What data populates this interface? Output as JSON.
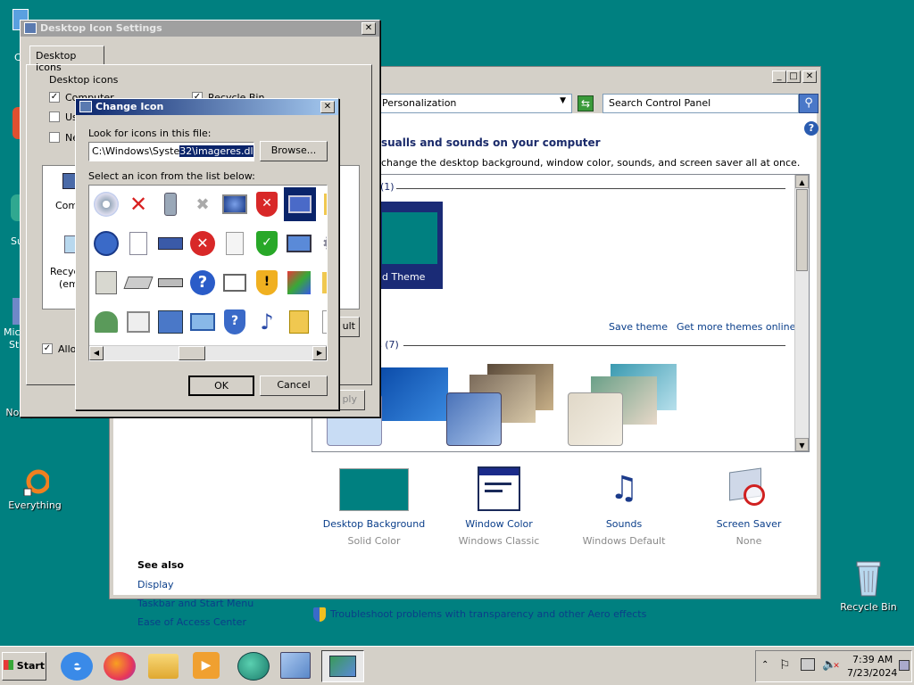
{
  "desktop": {
    "icons": [
      {
        "label": "Notepad++",
        "icon": "notepad-icon"
      },
      {
        "label": "Everything",
        "icon": "everything-icon"
      },
      {
        "label": "Recycle Bin",
        "icon": "recycle-bin-icon"
      }
    ],
    "partial_labels": [
      "C",
      "Su",
      "Micr",
      "Stu"
    ]
  },
  "control_panel": {
    "address": "Personalization",
    "search_placeholder": "Search Control Panel",
    "heading": "sualls and sounds on your computer",
    "subheading": "change the desktop background, window color, sounds, and screen saver all at once.",
    "my_themes_label": "(1)",
    "unsaved_theme_label": "d Theme",
    "save_theme": "Save theme",
    "get_more_themes": "Get more themes online",
    "basic_themes_label": "s (7)",
    "bottom_items": [
      {
        "title": "Desktop Background",
        "sub": "Solid Color",
        "icon": "desktop-background-icon"
      },
      {
        "title": "Window Color",
        "sub": "Windows Classic",
        "icon": "window-color-icon"
      },
      {
        "title": "Sounds",
        "sub": "Windows Default",
        "icon": "sounds-icon"
      },
      {
        "title": "Screen Saver",
        "sub": "None",
        "icon": "screen-saver-icon"
      }
    ],
    "see_also": "See also",
    "see_also_links": [
      "Display",
      "Taskbar and Start Menu",
      "Ease of Access Center"
    ],
    "troubleshoot": "Troubleshoot problems with transparency and other Aero effects"
  },
  "desktop_icon_settings": {
    "title": "Desktop Icon Settings",
    "tab": "Desktop Icons",
    "group": "Desktop icons",
    "checkboxes": [
      {
        "label": "Computer",
        "checked": true
      },
      {
        "label": "Recycle Bin",
        "checked": true
      },
      {
        "label": "Us",
        "checked": false
      },
      {
        "label": "Ne",
        "checked": false
      }
    ],
    "preview_labels": [
      "Comp",
      "Recyc",
      "(emp"
    ],
    "allow_label": "Allow",
    "default_button": "ult",
    "apply_button": "ply"
  },
  "change_icon": {
    "title": "Change Icon",
    "look_for_label": "Look for icons in this file:",
    "file_path_start": "C:\\Windows\\Syste",
    "file_path_selected": "32\\imageres.dll",
    "browse": "Browse...",
    "select_label": "Select an icon from the list below:",
    "ok": "OK",
    "cancel": "Cancel"
  },
  "taskbar": {
    "start": "Start",
    "time": "7:39 AM",
    "date": "7/23/2024"
  }
}
